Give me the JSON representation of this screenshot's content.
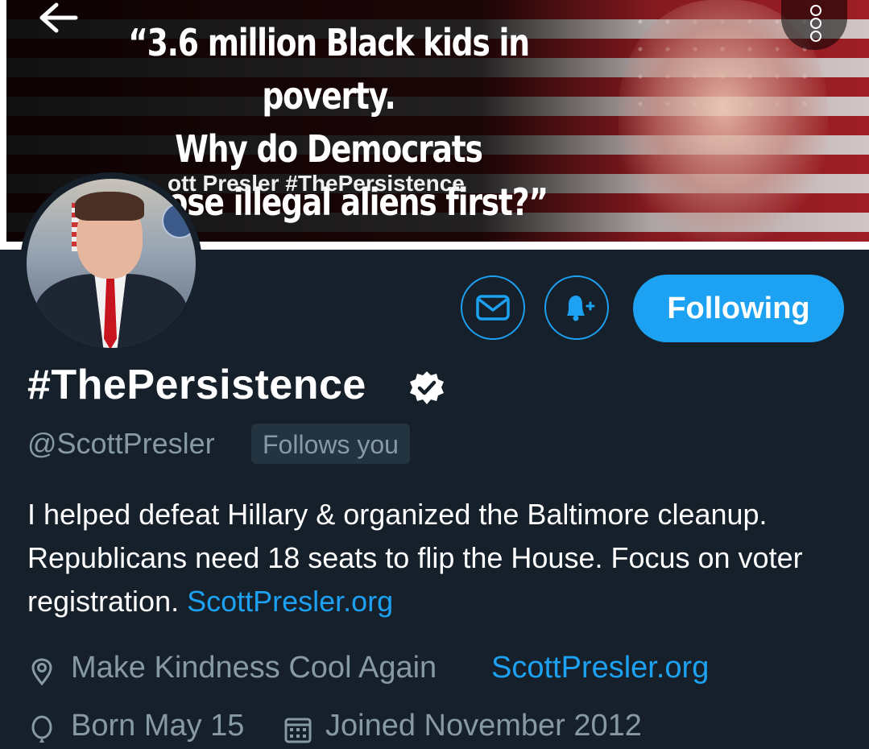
{
  "header": {
    "back_icon": "arrow-left-icon",
    "overflow_icon": "more-vertical-icon",
    "banner": {
      "quote_lines": [
        "“3.6 million Black kids in poverty.",
        "Why do Democrats",
        "choose illegal aliens first?”"
      ],
      "attribution": "ott Presler #ThePersistence"
    }
  },
  "profile": {
    "display_name": "#ThePersistence",
    "verified_icon": "verified-badge-icon",
    "handle": "@ScottPresler",
    "follows_you": "Follows you",
    "bio_text": "I helped defeat Hillary & organized the Baltimore cleanup. Republicans need 18 seats to flip the House. Focus on voter registration. ",
    "bio_link": "ScottPresler.org",
    "location": "Make Kindness Cool Again",
    "website": "ScottPresler.org",
    "birthday": "Born May 15",
    "joined": "Joined November 2012"
  },
  "actions": {
    "message_icon": "envelope-icon",
    "notify_icon": "bell-plus-icon",
    "following_label": "Following"
  },
  "colors": {
    "background": "#15202b",
    "accent": "#1da1f2",
    "muted": "#8899a6"
  }
}
